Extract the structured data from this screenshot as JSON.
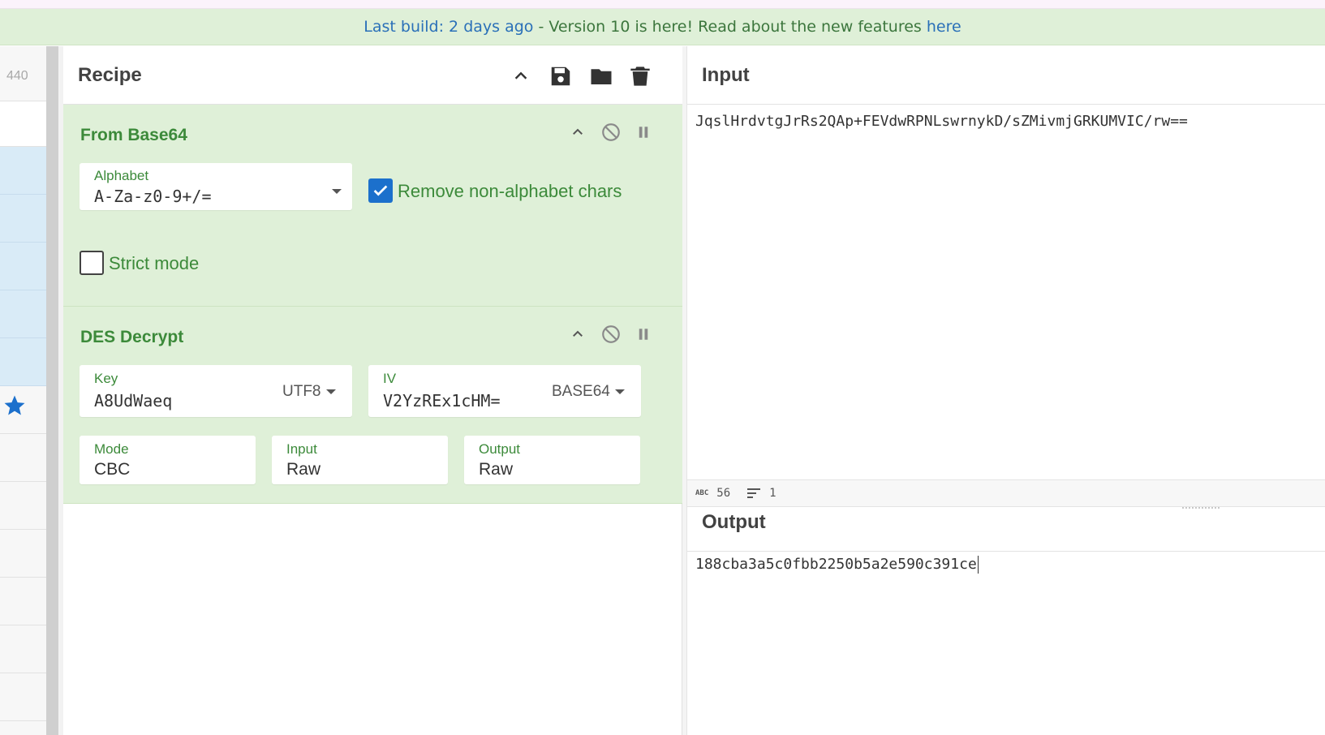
{
  "banner": {
    "link_last_build": "Last build: 2 days ago",
    "message": " - Version 10 is here! Read about the new features ",
    "link_here": "here"
  },
  "left_strip": {
    "number": "440"
  },
  "recipe": {
    "title": "Recipe",
    "operations": [
      {
        "title": "From Base64",
        "alphabet_label": "Alphabet",
        "alphabet_value": "A-Za-z0-9+/=",
        "remove_nonalpha_label": "Remove non-alphabet chars",
        "remove_nonalpha_checked": true,
        "strict_mode_label": "Strict mode",
        "strict_mode_checked": false
      },
      {
        "title": "DES Decrypt",
        "key_label": "Key",
        "key_value": "A8UdWaeq",
        "key_encoding": "UTF8",
        "iv_label": "IV",
        "iv_value": "V2YzREx1cHM=",
        "iv_encoding": "BASE64",
        "mode_label": "Mode",
        "mode_value": "CBC",
        "input_label": "Input",
        "input_value": "Raw",
        "output_label": "Output",
        "output_value": "Raw"
      }
    ]
  },
  "input_panel": {
    "title": "Input",
    "text": "JqslHrdvtgJrRs2QAp+FEVdwRPNLswrnykD/sZMivmjGRKUMVIC/rw==",
    "status_chars_icon": "ABC",
    "status_chars": "56",
    "status_lines": "1"
  },
  "output_panel": {
    "title": "Output",
    "text": "188cba3a5c0fbb2250b5a2e590c391ce"
  },
  "colors": {
    "accent_blue": "#1c70cc",
    "op_green_bg": "#dff0d8",
    "op_green_text": "#3c8a3a",
    "banner_link": "#2a70b8"
  },
  "icons": [
    "star-icon",
    "chevron-up-icon",
    "save-icon",
    "folder-icon",
    "trash-icon",
    "disable-icon",
    "pause-icon",
    "dropdown-caret-icon",
    "checkmark-icon",
    "lines-icon"
  ]
}
